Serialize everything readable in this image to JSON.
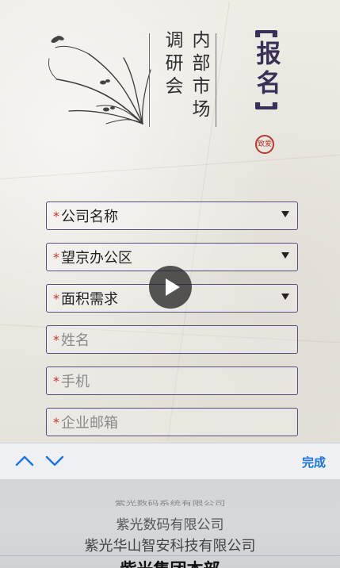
{
  "header": {
    "title_col_a": "调研会",
    "title_col_b": "内部市场",
    "signup": "报名",
    "seal_text": "致爱"
  },
  "form": {
    "fields": [
      {
        "required_mark": "*",
        "label": "公司名称",
        "type": "select"
      },
      {
        "required_mark": "*",
        "label": "望京办公区",
        "type": "select"
      },
      {
        "required_mark": "*",
        "label": "面积需求",
        "type": "select"
      },
      {
        "required_mark": "*",
        "label": "姓名",
        "type": "input"
      },
      {
        "required_mark": "*",
        "label": "手机",
        "type": "input"
      },
      {
        "required_mark": "*",
        "label": "企业邮箱",
        "type": "input"
      }
    ]
  },
  "video": {
    "icon": "play-icon"
  },
  "keyboard_toolbar": {
    "prev_icon": "chevron-up-icon",
    "next_icon": "chevron-down-icon",
    "done_label": "完成"
  },
  "picker": {
    "options": [
      "紫光数码系统有限公司",
      "紫光数码有限公司",
      "紫光华山智安科技有限公司",
      "紫光集团本部"
    ]
  },
  "colors": {
    "accent": "#5a4d82",
    "required": "#c0392b",
    "ios_blue": "#1a73e8",
    "seal": "#b43a2e"
  }
}
